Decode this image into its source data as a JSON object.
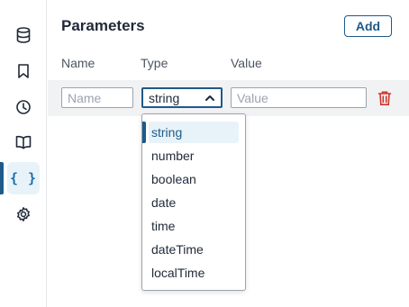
{
  "sidebar": {
    "items": [
      {
        "icon": "database-icon",
        "active": false
      },
      {
        "icon": "bookmark-icon",
        "active": false
      },
      {
        "icon": "history-icon",
        "active": false
      },
      {
        "icon": "book-icon",
        "active": false
      },
      {
        "icon": "braces-icon",
        "label": "{ }",
        "active": true
      },
      {
        "icon": "gear-icon",
        "active": false
      }
    ]
  },
  "panel": {
    "title": "Parameters",
    "add_label": "Add",
    "columns": [
      "Name",
      "Type",
      "Value"
    ]
  },
  "row": {
    "name_placeholder": "Name",
    "type_value": "string",
    "value_placeholder": "Value"
  },
  "dropdown": {
    "options": [
      "string",
      "number",
      "boolean",
      "date",
      "time",
      "dateTime",
      "localTime"
    ],
    "selected": "string"
  },
  "colors": {
    "accent": "#1e5a8a",
    "selected_bg": "#e8f3f9",
    "danger": "#d0342c"
  }
}
